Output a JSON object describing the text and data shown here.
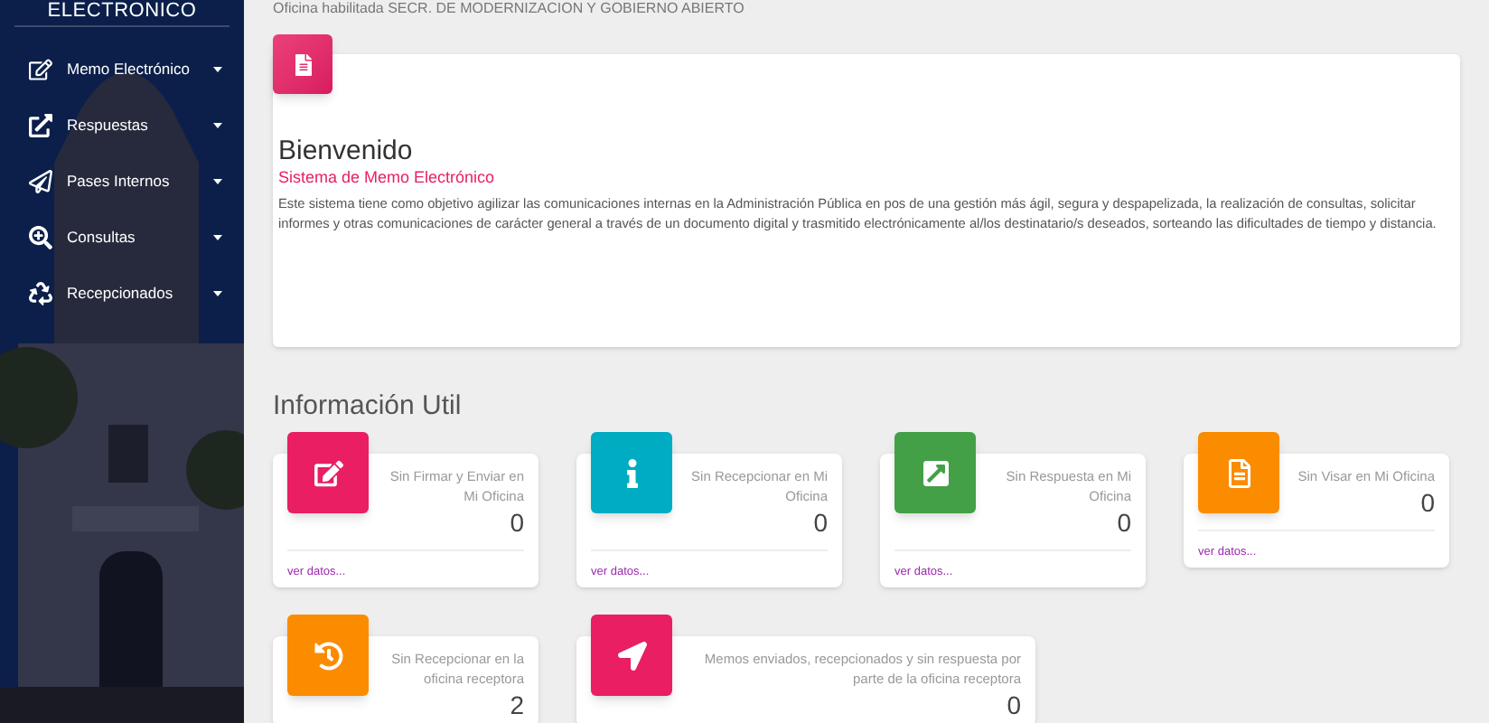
{
  "sidebar": {
    "brand": "ELECTRONICO",
    "items": [
      {
        "kind": "edit",
        "label": "Memo Electrónico"
      },
      {
        "kind": "external",
        "label": "Respuestas"
      },
      {
        "kind": "send",
        "label": "Pases Internos"
      },
      {
        "kind": "search",
        "label": "Consultas"
      },
      {
        "kind": "recycle",
        "label": "Recepcionados"
      }
    ]
  },
  "header": {
    "office": "Oficina habilitada SECR. DE MODERNIZACION Y GOBIERNO ABIERTO"
  },
  "welcome": {
    "title": "Bienvenido",
    "subtitle": "Sistema de Memo Electrónico",
    "body": "Este sistema tiene como objetivo agilizar las comunicaciones internas en la Administración Pública en pos de una gestión más ágil, segura y despapelizada, la realización de consultas, solicitar informes y otras comunicaciones de carácter general a través de un documento digital y trasmitido electrónicamente al/los destinatario/s deseados, sorteando las dificultades de tiempo y distancia."
  },
  "info": {
    "title": "Información Util",
    "cards": [
      {
        "kind": "edit",
        "color": "#e91e63",
        "label": "Sin Firmar y Enviar en Mi Oficina",
        "count": "0",
        "link": "ver datos..."
      },
      {
        "kind": "info",
        "color": "#00acc1",
        "label": "Sin Recepcionar en Mi Oficina",
        "count": "0",
        "link": "ver datos..."
      },
      {
        "kind": "external",
        "color": "#43a047",
        "label": "Sin Respuesta en Mi Oficina",
        "count": "0",
        "link": "ver datos..."
      },
      {
        "kind": "file",
        "color": "#fb8c00",
        "label": "Sin Visar en Mi Oficina",
        "count": "0",
        "link": "ver datos..."
      },
      {
        "kind": "history",
        "color": "#fb8c00",
        "label": "Sin Recepcionar en la oficina receptora",
        "count": "2"
      },
      {
        "kind": "send",
        "color": "#e91e63",
        "label": "Memos enviados, recepcionados y sin respuesta por parte de la oficina receptora",
        "count": "0"
      }
    ]
  }
}
